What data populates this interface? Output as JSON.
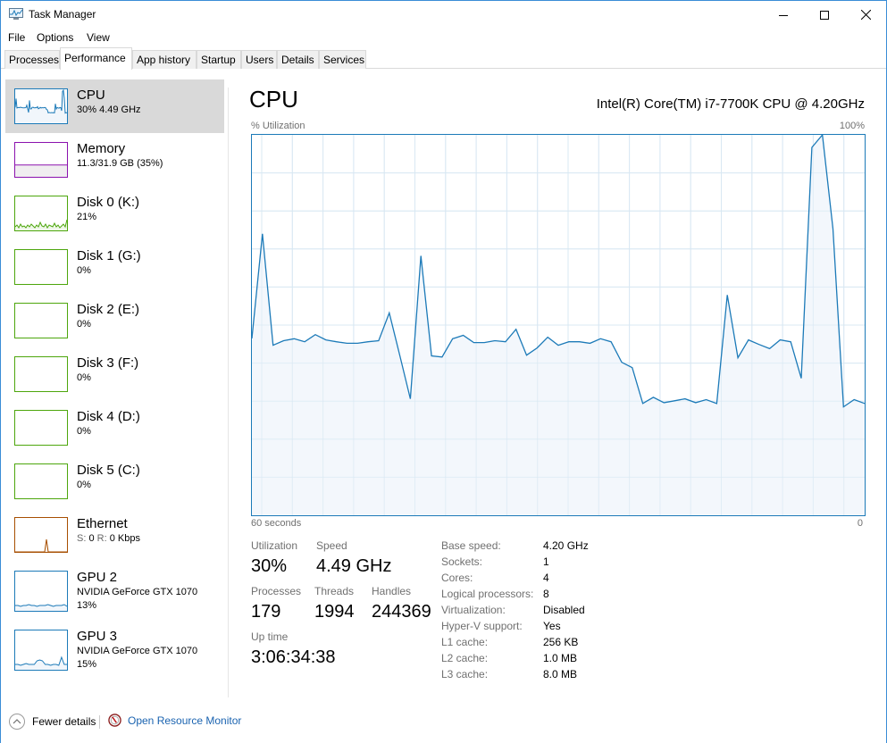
{
  "window": {
    "title": "Task Manager",
    "controls": {
      "minimize": "minimize-icon",
      "maximize": "maximize-icon",
      "close": "close-icon"
    }
  },
  "menu": [
    "File",
    "Options",
    "View"
  ],
  "tabs": [
    {
      "label": "Processes",
      "active": false
    },
    {
      "label": "Performance",
      "active": true
    },
    {
      "label": "App history",
      "active": false
    },
    {
      "label": "Startup",
      "active": false
    },
    {
      "label": "Users",
      "active": false
    },
    {
      "label": "Details",
      "active": false
    },
    {
      "label": "Services",
      "active": false
    }
  ],
  "sidebar": {
    "items": [
      {
        "name": "CPU",
        "sub": "30% 4.49 GHz",
        "color": "#1c7ab8",
        "fill": "#f1f6fb",
        "selected": true,
        "kind": "cpu"
      },
      {
        "name": "Memory",
        "sub": "11.3/31.9 GB (35%)",
        "color": "#8b12ae",
        "fill": "#f4f2f4",
        "selected": false,
        "kind": "memory",
        "used_fraction": 0.35
      },
      {
        "name": "Disk 0 (K:)",
        "sub": "21%",
        "color": "#4da60c",
        "fill": "#eff7e8",
        "selected": false,
        "kind": "disk-active"
      },
      {
        "name": "Disk 1 (G:)",
        "sub": "0%",
        "color": "#4da60c",
        "fill": "#eff7e8",
        "selected": false,
        "kind": "empty"
      },
      {
        "name": "Disk 2 (E:)",
        "sub": "0%",
        "color": "#4da60c",
        "fill": "#eff7e8",
        "selected": false,
        "kind": "empty"
      },
      {
        "name": "Disk 3 (F:)",
        "sub": "0%",
        "color": "#4da60c",
        "fill": "#eff7e8",
        "selected": false,
        "kind": "empty"
      },
      {
        "name": "Disk 4 (D:)",
        "sub": "0%",
        "color": "#4da60c",
        "fill": "#eff7e8",
        "selected": false,
        "kind": "empty"
      },
      {
        "name": "Disk 5 (C:)",
        "sub": "0%",
        "color": "#4da60c",
        "fill": "#eff7e8",
        "selected": false,
        "kind": "empty"
      },
      {
        "name": "Ethernet",
        "sub_send_label": "S:",
        "sub_send": "0",
        "sub_recv_label": "R:",
        "sub_recv": "0 Kbps",
        "color": "#a74f01",
        "fill": "#fcf3eb",
        "selected": false,
        "kind": "ethernet"
      },
      {
        "name": "GPU 2",
        "sub": "NVIDIA GeForce GTX 1070",
        "sub2": "13%",
        "color": "#1c7ab8",
        "fill": "#f1f6fb",
        "selected": false,
        "kind": "gpu2"
      },
      {
        "name": "GPU 3",
        "sub": "NVIDIA GeForce GTX 1070",
        "sub2": "15%",
        "color": "#1c7ab8",
        "fill": "#f1f6fb",
        "selected": false,
        "kind": "gpu3"
      }
    ]
  },
  "main": {
    "title": "CPU",
    "model": "Intel(R) Core(TM) i7-7700K CPU @ 4.20GHz",
    "y_label": "% Utilization",
    "y_max_label": "100%",
    "x_left_label": "60 seconds",
    "x_right_label": "0",
    "stats": {
      "utilization_label": "Utilization",
      "utilization": "30%",
      "speed_label": "Speed",
      "speed": "4.49 GHz",
      "processes_label": "Processes",
      "processes": "179",
      "threads_label": "Threads",
      "threads": "1994",
      "handles_label": "Handles",
      "handles": "244369",
      "uptime_label": "Up time",
      "uptime": "3:06:34:38"
    },
    "details": [
      {
        "label": "Base speed:",
        "value": "4.20 GHz"
      },
      {
        "label": "Sockets:",
        "value": "1"
      },
      {
        "label": "Cores:",
        "value": "4"
      },
      {
        "label": "Logical processors:",
        "value": "8"
      },
      {
        "label": "Virtualization:",
        "value": "Disabled"
      },
      {
        "label": "Hyper-V support:",
        "value": "Yes"
      },
      {
        "label": "L1 cache:",
        "value": "256 KB"
      },
      {
        "label": "L2 cache:",
        "value": "1.0 MB"
      },
      {
        "label": "L3 cache:",
        "value": "8.0 MB"
      }
    ]
  },
  "footer": {
    "fewer_details": "Fewer details",
    "open_resource_monitor": "Open Resource Monitor"
  },
  "colors": {
    "cpu_line": "#1c7ab8",
    "cpu_fill": "#f1f6fb",
    "grid": "#d9e8f3",
    "link": "#1a63b0"
  },
  "chart_data": {
    "type": "area",
    "title": "CPU",
    "ylabel": "% Utilization",
    "xlabel": "",
    "x_range_label": [
      "60 seconds",
      "0"
    ],
    "ylim": [
      0,
      100
    ],
    "xlim": [
      60,
      0
    ],
    "grid": true,
    "series": [
      {
        "name": "CPU utilization",
        "values": [
          46.5,
          74,
          44.7,
          45.9,
          46.4,
          45.6,
          47.5,
          46.1,
          45.6,
          45.2,
          45.2,
          45.6,
          45.9,
          53.2,
          42,
          30.6,
          68.2,
          41.9,
          41.6,
          46.4,
          47.3,
          45.4,
          45.4,
          45.9,
          45.6,
          48.9,
          42.1,
          44,
          46.8,
          44.7,
          45.6,
          45.6,
          45.2,
          46.4,
          45.6,
          40.2,
          38.8,
          29.4,
          31,
          29.6,
          30.1,
          30.6,
          29.6,
          30.4,
          29.4,
          57.9,
          41.4,
          46.1,
          44.9,
          43.8,
          46.1,
          45.6,
          36,
          96.7,
          100,
          75.3,
          28.5,
          30.4,
          29.4
        ]
      }
    ]
  }
}
